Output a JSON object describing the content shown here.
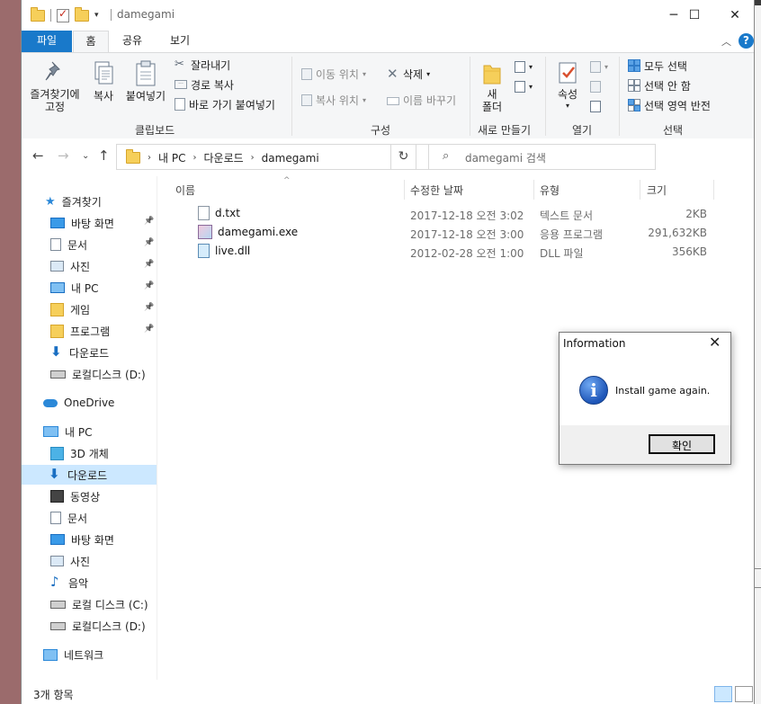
{
  "window": {
    "title": "damegami",
    "controls": {
      "minimize": "─",
      "maximize": "☐",
      "close": "✕"
    }
  },
  "ribbon": {
    "tabs": [
      {
        "label": "파일"
      },
      {
        "label": "홈"
      },
      {
        "label": "공유"
      },
      {
        "label": "보기"
      }
    ],
    "active_tab": "홈",
    "clipboard": {
      "group_label": "클립보드",
      "pin_quick_access": "즐겨찾기에\n고정",
      "copy": "복사",
      "paste": "붙여넣기",
      "cut": "잘라내기",
      "copy_path": "경로 복사",
      "paste_shortcut": "바로 가기 붙여넣기"
    },
    "organize": {
      "group_label": "구성",
      "move_to": "이동 위치",
      "copy_to": "복사 위치",
      "delete": "삭제",
      "rename": "이름 바꾸기"
    },
    "new": {
      "group_label": "새로 만들기",
      "new_folder": "새\n폴더"
    },
    "open": {
      "group_label": "열기",
      "properties": "속성"
    },
    "select": {
      "group_label": "선택",
      "select_all": "모두 선택",
      "select_none": "선택 안 함",
      "invert_selection": "선택 영역 반전"
    }
  },
  "address": {
    "crumbs": [
      "내 PC",
      "다운로드",
      "damegami"
    ],
    "search_placeholder": "damegami 검색"
  },
  "nav_pane": {
    "quick_access": "즐겨찾기",
    "quick_items": [
      {
        "label": "바탕 화면",
        "icon": "desktop-icon"
      },
      {
        "label": "문서",
        "icon": "documents-icon"
      },
      {
        "label": "사진",
        "icon": "pictures-icon"
      },
      {
        "label": "내 PC",
        "icon": "pc-icon"
      },
      {
        "label": "게임",
        "icon": "folder-icon"
      },
      {
        "label": "프로그램",
        "icon": "folder-icon"
      },
      {
        "label": "다운로드",
        "icon": "downloads-icon"
      },
      {
        "label": "로컬디스크 (D:)",
        "icon": "drive-icon"
      }
    ],
    "onedrive": "OneDrive",
    "this_pc": "내 PC",
    "pc_items": [
      {
        "label": "3D 개체",
        "icon": "3d-objects-icon"
      },
      {
        "label": "다운로드",
        "icon": "downloads-icon"
      },
      {
        "label": "동영상",
        "icon": "videos-icon"
      },
      {
        "label": "문서",
        "icon": "documents-icon"
      },
      {
        "label": "바탕 화면",
        "icon": "desktop-icon"
      },
      {
        "label": "사진",
        "icon": "pictures-icon"
      },
      {
        "label": "음악",
        "icon": "music-icon"
      },
      {
        "label": "로컬 디스크 (C:)",
        "icon": "windows-drive-icon"
      },
      {
        "label": "로컬디스크 (D:)",
        "icon": "drive-icon"
      }
    ],
    "network": "네트워크",
    "selected": "다운로드"
  },
  "file_list": {
    "columns": {
      "name": "이름",
      "modified": "수정한 날짜",
      "type": "유형",
      "size": "크기"
    },
    "files": [
      {
        "name": "d.txt",
        "modified": "2017-12-18 오전 3:02",
        "type": "텍스트 문서",
        "size": "2KB",
        "icon": "text-file-icon"
      },
      {
        "name": "damegami.exe",
        "modified": "2017-12-18 오전 3:00",
        "type": "응용 프로그램",
        "size": "291,632KB",
        "icon": "exe-file-icon"
      },
      {
        "name": "live.dll",
        "modified": "2012-02-28 오전 1:00",
        "type": "DLL 파일",
        "size": "356KB",
        "icon": "dll-file-icon"
      }
    ]
  },
  "status": {
    "item_count": "3개 항목"
  },
  "dialog": {
    "title": "Information",
    "message": "Install game again.",
    "ok_label": "확인"
  }
}
